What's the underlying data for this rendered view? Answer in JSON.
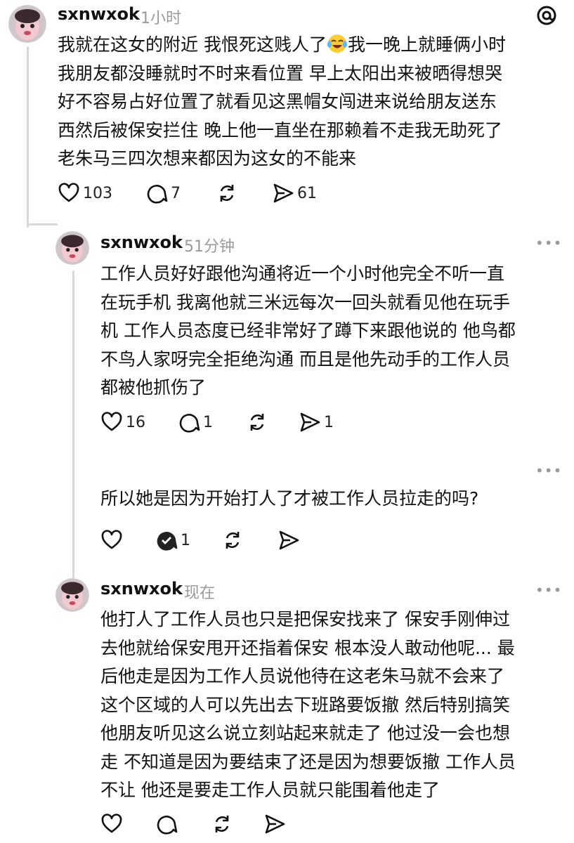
{
  "app_logo": "threads-logo-icon",
  "posts": [
    {
      "username": "sxnwxok",
      "time": "1小时",
      "text_before_emoji": "我就在这女的附近 我恨死这贱人了",
      "emoji": "laughing-crying-emoji",
      "text_after_emoji": "我一晚上就睡俩小时\n我朋友都没睡就时不时来看位置 早上太阳出来被晒得想哭\n好不容易占好位置了就看见这黑帽女闯进来说给朋友送东\n西然后被保安拦住 晚上他一直坐在那赖着不走我无助死了\n老朱马三四次想来都因为这女的不能来",
      "likes": "103",
      "comments": "7",
      "shares": "61"
    },
    {
      "username": "sxnwxok",
      "time": "51分钟",
      "more": "•••",
      "text": "工作人员好好跟他沟通将近一个小时他完全不听一直\n在玩手机 我离他就三米远每次一回头就看见他在玩手\n机 工作人员态度已经非常好了蹲下来跟他说的 他鸟都\n不鸟人家呀完全拒绝沟通 而且是他先动手的工作人员\n都被他抓伤了",
      "likes": "16",
      "comments": "1",
      "shares": "1"
    },
    {
      "more": "•••",
      "text": "所以她是因为开始打人了才被工作人员拉走的吗?",
      "comments": "1"
    },
    {
      "username": "sxnwxok",
      "time": "现在",
      "more": "•••",
      "text": "他打人了工作人员也只是把保安找来了 保安手刚伸过\n去他就给保安甩开还指着保安 根本没人敢动他呢... 最\n后他走是因为工作人员说他待在这老朱马就不会来了\n这个区域的人可以先出去下班路要饭撤 然后特别搞笑\n他朋友听见这么说立刻站起来就走了 他过没一会也想\n走 不知道是因为要结束了还是因为想要饭撤 工作人员\n不让 他还是要走工作人员就只能围着他走了"
    }
  ]
}
